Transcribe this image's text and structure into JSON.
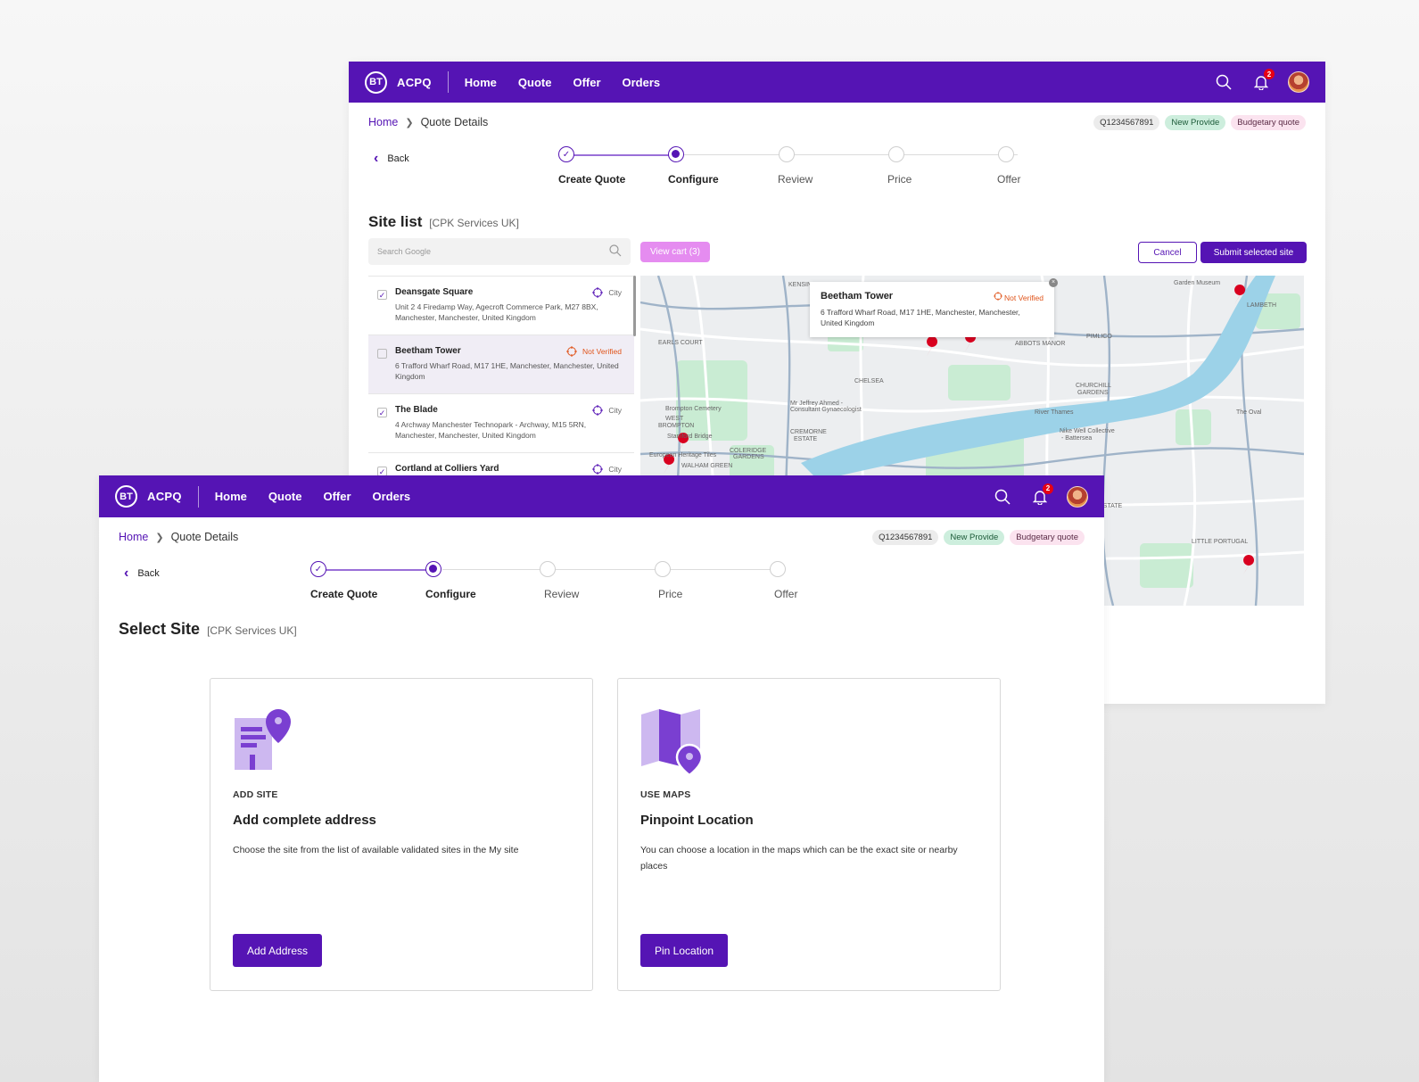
{
  "app": {
    "logo_text": "BT",
    "name": "ACPQ",
    "nav": [
      "Home",
      "Quote",
      "Offer",
      "Orders"
    ],
    "notification_count": "2"
  },
  "breadcrumb": {
    "home": "Home",
    "current": "Quote Details"
  },
  "tags": {
    "quote_id": "Q1234567891",
    "provide": "New Provide",
    "quote_type": "Budgetary quote"
  },
  "back_label": "Back",
  "steps": [
    {
      "label": "Create Quote",
      "state": "done"
    },
    {
      "label": "Configure",
      "state": "active"
    },
    {
      "label": "Review",
      "state": "pending"
    },
    {
      "label": "Price",
      "state": "pending"
    },
    {
      "label": "Offer",
      "state": "pending"
    }
  ],
  "site_list_screen": {
    "title": "Site list",
    "subtitle": "[CPK Services UK]",
    "search_placeholder": "Search Google",
    "view_cart": "View cart (3)",
    "cancel": "Cancel",
    "submit": "Submit selected site",
    "sites": [
      {
        "name": "Deansgate Square",
        "address": "Unit 2 4 Firedamp Way, Agecroft Commerce Park, M27 8BX, Manchester, Manchester, United Kingdom",
        "status": "City",
        "checked": true
      },
      {
        "name": "Beetham Tower",
        "address": "6 Trafford Wharf Road, M17 1HE, Manchester, Manchester, United Kingdom",
        "status": "Not Verified",
        "checked": false
      },
      {
        "name": "The Blade",
        "address": "4 Archway Manchester Technopark - Archway, M15 5RN, Manchester, Manchester, United Kingdom",
        "status": "City",
        "checked": true
      },
      {
        "name": "Cortland at Colliers Yard",
        "address": "",
        "status": "City",
        "checked": true
      }
    ],
    "map_popup": {
      "name": "Beetham Tower",
      "status": "Not Verified",
      "address": "6 Trafford Wharf Road, M17 1HE, Manchester, Manchester, United Kingdom"
    },
    "map_labels": [
      "KENSIN",
      "EARLS COURT",
      "CHELSEA",
      "ABBOTS MANOR",
      "PIMLICO",
      "CHURCHILL GARDENS",
      "LAMBETH",
      "Brompton Cemetery",
      "WEST BROMPTON",
      "Stamford Bridge",
      "COLERIDGE GARDENS",
      "CREMORNE ESTATE",
      "Mr Jeffrey Ahmed - Consultant Gynaecologist",
      "River Thames",
      "Nike Well Collective - Battersea",
      "The Oval",
      "European Heritage Tiles",
      "WALHAM GREEN",
      "ESTATE",
      "LITTLE PORTUGAL",
      "Garden Museum"
    ]
  },
  "select_site_screen": {
    "title": "Select Site",
    "subtitle": "[CPK Services UK]",
    "cards": [
      {
        "kicker": "ADD SITE",
        "heading": "Add complete address",
        "description": "Choose the site from the list of available validated sites in the My site",
        "button": "Add Address"
      },
      {
        "kicker": "USE MAPS",
        "heading": "Pinpoint Location",
        "description": "You can choose a location in the maps which can be the exact site or nearby places",
        "button": "Pin Location"
      }
    ]
  },
  "colors": {
    "brand": "#5514b4",
    "alert": "#e60014",
    "warning": "#e0541a",
    "cart": "#e58cf0"
  }
}
